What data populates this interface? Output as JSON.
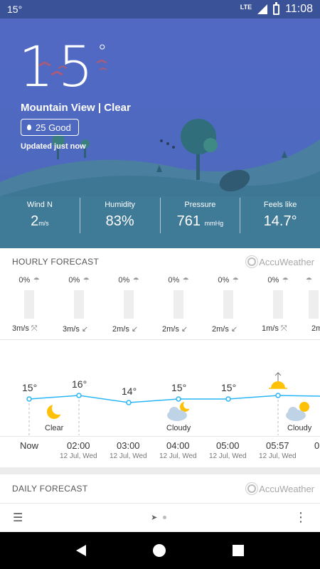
{
  "status_bar": {
    "notif_temp": "15°",
    "network": "LTE",
    "time": "11:08"
  },
  "hero": {
    "temp": "15",
    "deg": "°",
    "location": "Mountain View",
    "separator": "|",
    "condition": "Clear",
    "aqi_label": "25 Good",
    "updated": "Updated just now"
  },
  "stats": [
    {
      "label": "Wind N",
      "value": "2",
      "unit": "m/s"
    },
    {
      "label": "Humidity",
      "value": "83%",
      "unit": ""
    },
    {
      "label": "Pressure",
      "value": "761",
      "unit": "mmHg"
    },
    {
      "label": "Feels like",
      "value": "14.7°",
      "unit": ""
    }
  ],
  "hourly": {
    "title": "HOURLY FORECAST",
    "provider": "AccuWeather",
    "precip": [
      "0%",
      "0%",
      "0%",
      "0%",
      "0%",
      "0%"
    ],
    "wind": [
      "3m/s",
      "3m/s",
      "2m/s",
      "2m/s",
      "2m/s",
      "1m/s",
      "2m"
    ],
    "temps": [
      "15°",
      "16°",
      "14°",
      "15°",
      "15°"
    ],
    "conditions": [
      "Clear",
      "Cloudy",
      "Cloudy"
    ],
    "hours": [
      "Now",
      "02:00",
      "03:00",
      "04:00",
      "05:00",
      "05:57",
      "0"
    ],
    "dates": [
      "12 Jul, Wed",
      "12 Jul, Wed",
      "12 Jul, Wed",
      "12 Jul, Wed",
      "12 Jul, Wed"
    ]
  },
  "daily": {
    "title": "DAILY FORECAST",
    "provider": "AccuWeather"
  },
  "icons": {
    "umbrella": "umbrella-icon",
    "wind": "wind-icon",
    "moon": "moon-icon",
    "cloud": "cloud-moon-icon",
    "sunrise": "sunrise-icon",
    "menu": "menu-add-icon",
    "location": "location-arrow-icon",
    "more": "more-vert-icon"
  },
  "colors": {
    "hero_bg": "#5269c4",
    "status_bg": "#3a5298",
    "chart_line": "#29b6f6",
    "moon": "#ffc107"
  }
}
